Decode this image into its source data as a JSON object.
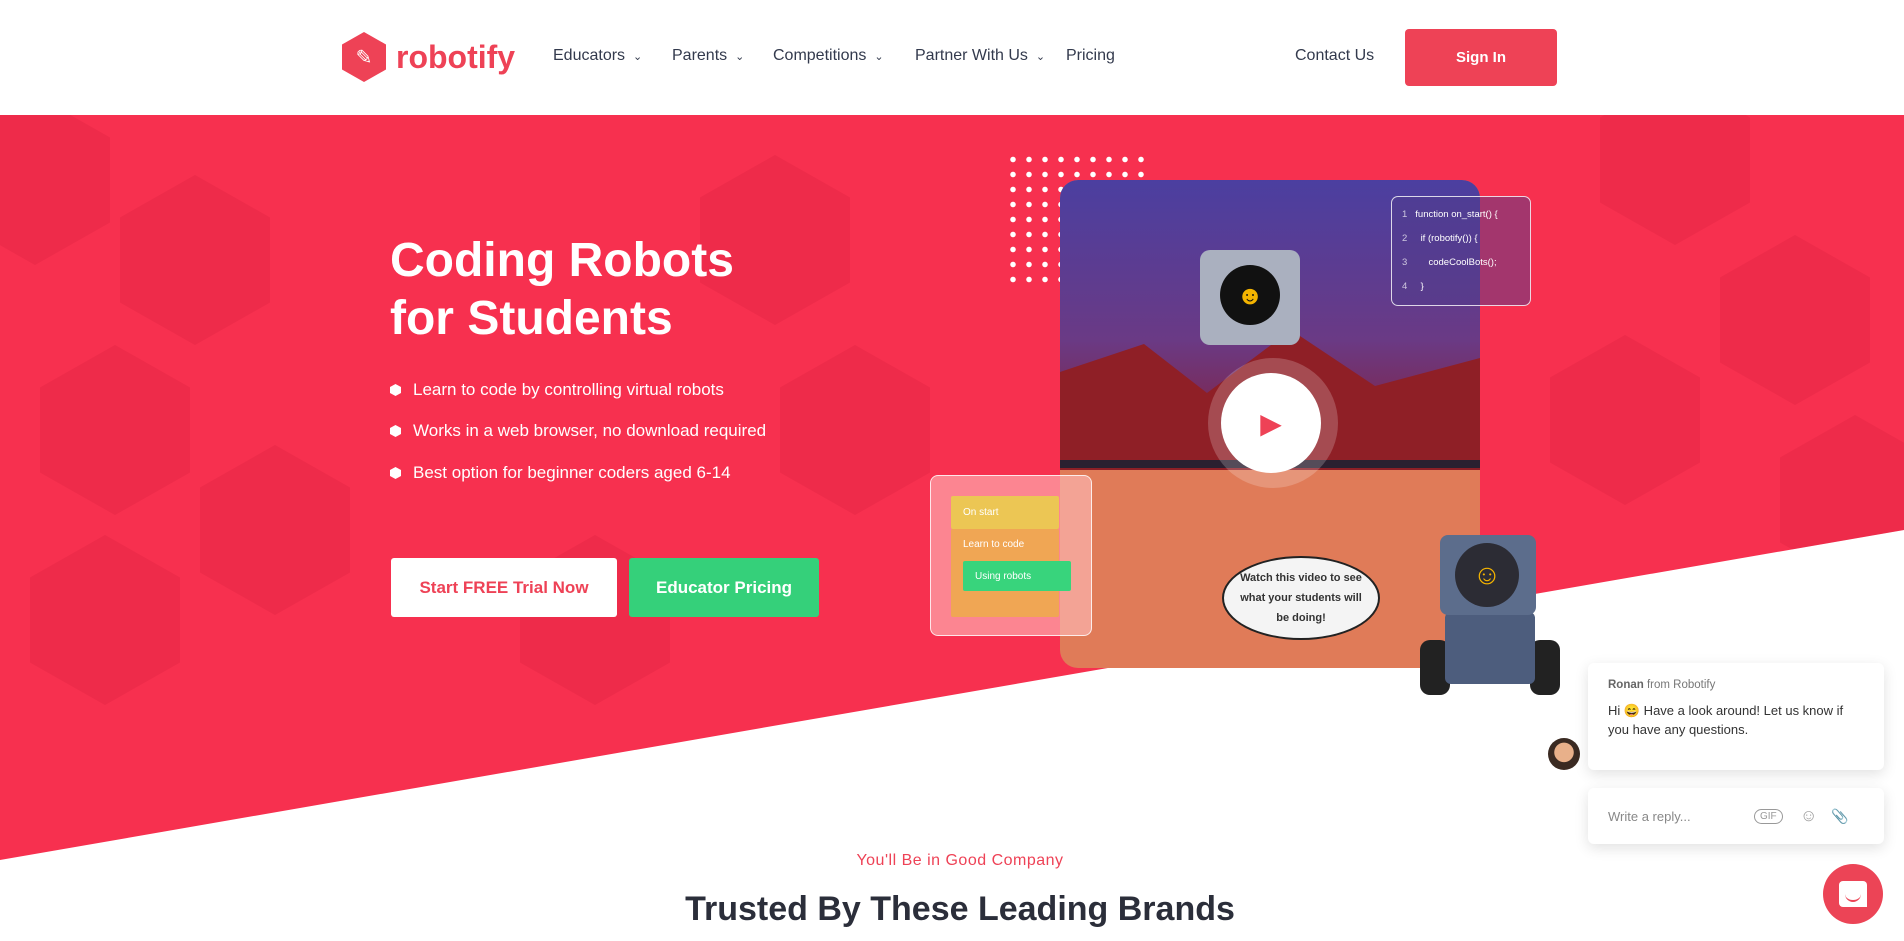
{
  "nav": {
    "logo": "robotify",
    "items": [
      {
        "label": "Educators"
      },
      {
        "label": "Parents"
      },
      {
        "label": "Competitions"
      },
      {
        "label": "Partner With Us"
      },
      {
        "label": "Pricing"
      }
    ],
    "contact": "Contact Us",
    "signin": "Sign In"
  },
  "hero": {
    "title_line1": "Coding Robots",
    "title_line2": "for Students",
    "bullets": [
      "Learn to code by controlling virtual robots",
      "Works in a web browser, no download required",
      "Best option for beginner coders aged 6-14"
    ],
    "cta_trial": "Start FREE Trial Now",
    "cta_pricing": "Educator Pricing"
  },
  "video": {
    "code": [
      {
        "n": "1",
        "t": "function on_start() {"
      },
      {
        "n": "2",
        "t": "  if (robotify()) {"
      },
      {
        "n": "3",
        "t": "     codeCoolBots();"
      },
      {
        "n": "4",
        "t": "  }"
      }
    ],
    "blocks": [
      "On start",
      "Learn to code",
      "Using robots"
    ],
    "bubble": "Watch this video to see what your students will be doing!"
  },
  "chat": {
    "name": "Ronan",
    "from": "from Robotify",
    "message": "Hi 😄 Have a look around! Let us know if you have any questions.",
    "reply_placeholder": "Write a reply...",
    "gif": "GIF"
  },
  "brands": {
    "subtitle": "You'll Be in Good Company",
    "title": "Trusted By These Leading Brands"
  },
  "colors": {
    "brand": "#ee4256",
    "hero": "#f7304f",
    "green": "#35d07a"
  }
}
